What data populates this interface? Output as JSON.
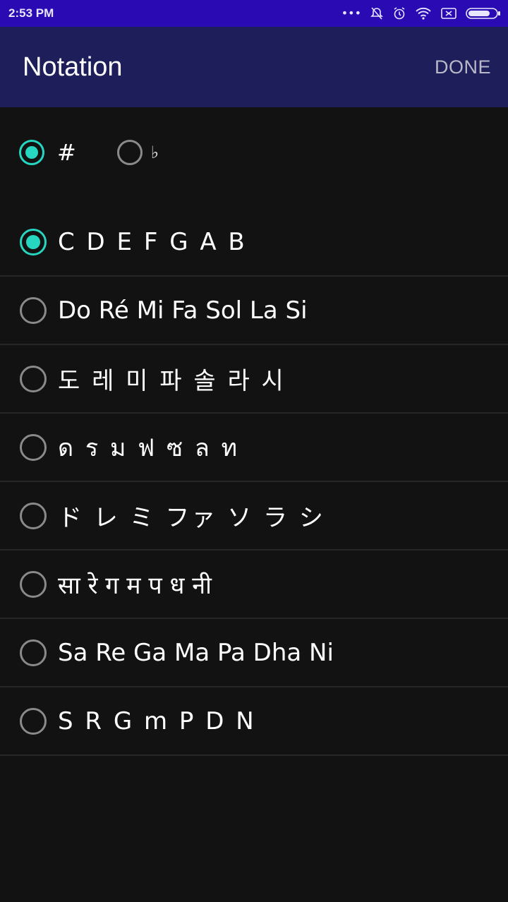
{
  "status_bar": {
    "time": "2:53 PM",
    "icons": [
      "more-dots-icon",
      "bell-off-icon",
      "alarm-icon",
      "wifi-icon",
      "sim-icon",
      "battery-icon"
    ]
  },
  "app_bar": {
    "title": "Notation",
    "done_label": "DONE"
  },
  "accidentals": [
    {
      "label": "#",
      "selected": true
    },
    {
      "label": "♭",
      "selected": false
    }
  ],
  "notations": [
    {
      "label": "C D E F G A B",
      "selected": true
    },
    {
      "label": "Do Ré Mi Fa Sol La Si",
      "selected": false
    },
    {
      "label": "도 레 미 파 솔 라 시",
      "selected": false
    },
    {
      "label": "ด ร ม ฟ ซ ล ท",
      "selected": false
    },
    {
      "label": "ド レ ミ ファ ソ ラ シ",
      "selected": false
    },
    {
      "label": "सा रे ग म प ध नी",
      "selected": false
    },
    {
      "label": "Sa Re Ga Ma Pa Dha Ni",
      "selected": false
    },
    {
      "label": "S R G m P D N",
      "selected": false
    }
  ],
  "colors": {
    "status_bar": "#2a0ab2",
    "app_bar": "#1e1f5a",
    "background": "#121212",
    "accent": "#27d6c0"
  }
}
